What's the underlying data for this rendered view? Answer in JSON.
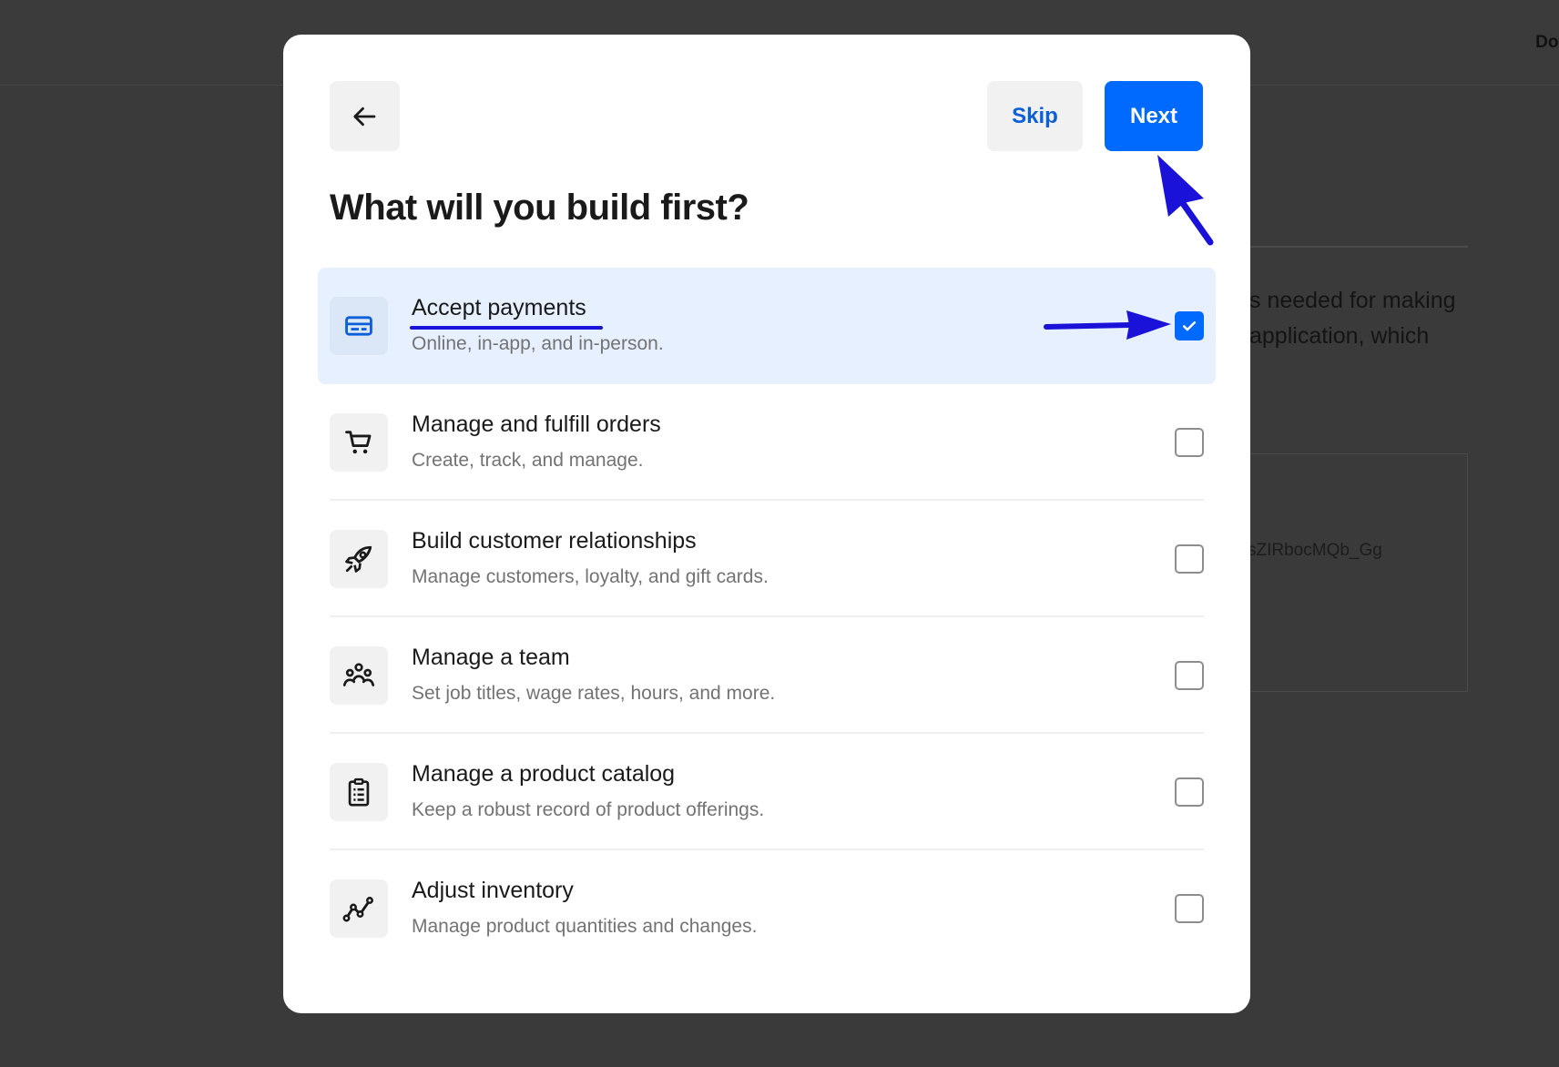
{
  "background": {
    "docs_link": "Doc",
    "text_line_1": "s needed for making",
    "text_line_2": "application, which",
    "token": "sZIRbocMQb_Gg"
  },
  "modal": {
    "back_icon": "arrow-left-icon",
    "skip_label": "Skip",
    "next_label": "Next",
    "title": "What will you build first?",
    "options": [
      {
        "icon": "credit-card-icon",
        "title": "Accept payments",
        "description": "Online, in-app, and in-person.",
        "checked": true
      },
      {
        "icon": "shopping-cart-icon",
        "title": "Manage and fulfill orders",
        "description": "Create, track, and manage.",
        "checked": false
      },
      {
        "icon": "rocket-icon",
        "title": "Build customer relationships",
        "description": "Manage customers, loyalty, and gift cards.",
        "checked": false
      },
      {
        "icon": "team-icon",
        "title": "Manage a team",
        "description": "Set job titles, wage rates, hours, and more.",
        "checked": false
      },
      {
        "icon": "clipboard-list-icon",
        "title": "Manage a product catalog",
        "description": "Keep a robust record of product offerings.",
        "checked": false
      },
      {
        "icon": "trend-line-icon",
        "title": "Adjust inventory",
        "description": "Manage product quantities and changes.",
        "checked": false
      }
    ]
  },
  "colors": {
    "primary": "#006aff",
    "annotation": "#1a12d9",
    "selected_bg": "#e6f0fe",
    "overlay": "#3a3a3a"
  }
}
